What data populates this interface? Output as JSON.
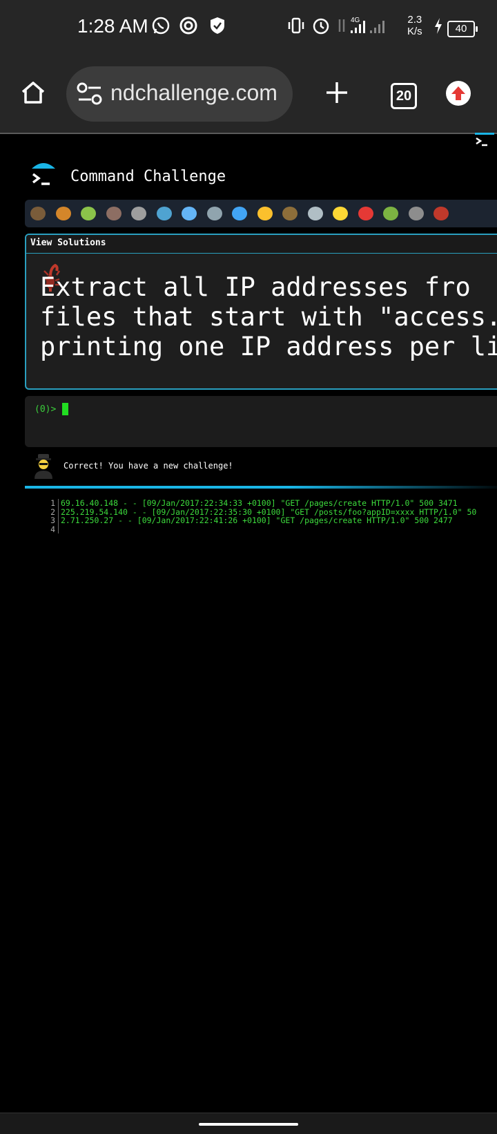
{
  "status_bar": {
    "time": "1:28 AM",
    "network_speed_value": "2.3",
    "network_speed_unit": "K/s",
    "network_type": "4G",
    "battery_level": "40"
  },
  "browser": {
    "url": "ndchallenge.com",
    "tab_count": "20",
    "accent_color": "#e53935"
  },
  "app": {
    "title": "Command Challenge",
    "view_solutions_label": "View Solutions",
    "challenge_text": "Extract all IP addresses fro\nfiles that start with \"access.\nprinting one IP address per li",
    "prompt": "(0)>",
    "message": "Correct! You have a new challenge!",
    "accent_color": "#1ab5e6"
  },
  "output": {
    "lines": [
      {
        "num": "1",
        "text": "69.16.40.148 - - [09/Jan/2017:22:34:33 +0100] \"GET /pages/create HTTP/1.0\" 500 3471"
      },
      {
        "num": "2",
        "text": "225.219.54.140 - - [09/Jan/2017:22:35:30 +0100] \"GET /posts/foo?appID=xxxx HTTP/1.0\" 50"
      },
      {
        "num": "3",
        "text": "2.71.250.27 - - [09/Jan/2017:22:41:26 +0100] \"GET /pages/create HTTP/1.0\" 500 2477"
      },
      {
        "num": "4",
        "text": ""
      }
    ]
  },
  "animal_icons": [
    "snail-icon",
    "butterfly-icon",
    "caterpillar-icon",
    "ant-icon",
    "spider-web-icon",
    "whale-icon",
    "dolphin-icon",
    "shark-icon",
    "fish-icon",
    "tropical-fish-icon",
    "blowfish-icon",
    "wolf-icon",
    "bee-icon",
    "ladybug-icon",
    "lizard-icon",
    "cricket-icon",
    "scorpion-icon"
  ]
}
